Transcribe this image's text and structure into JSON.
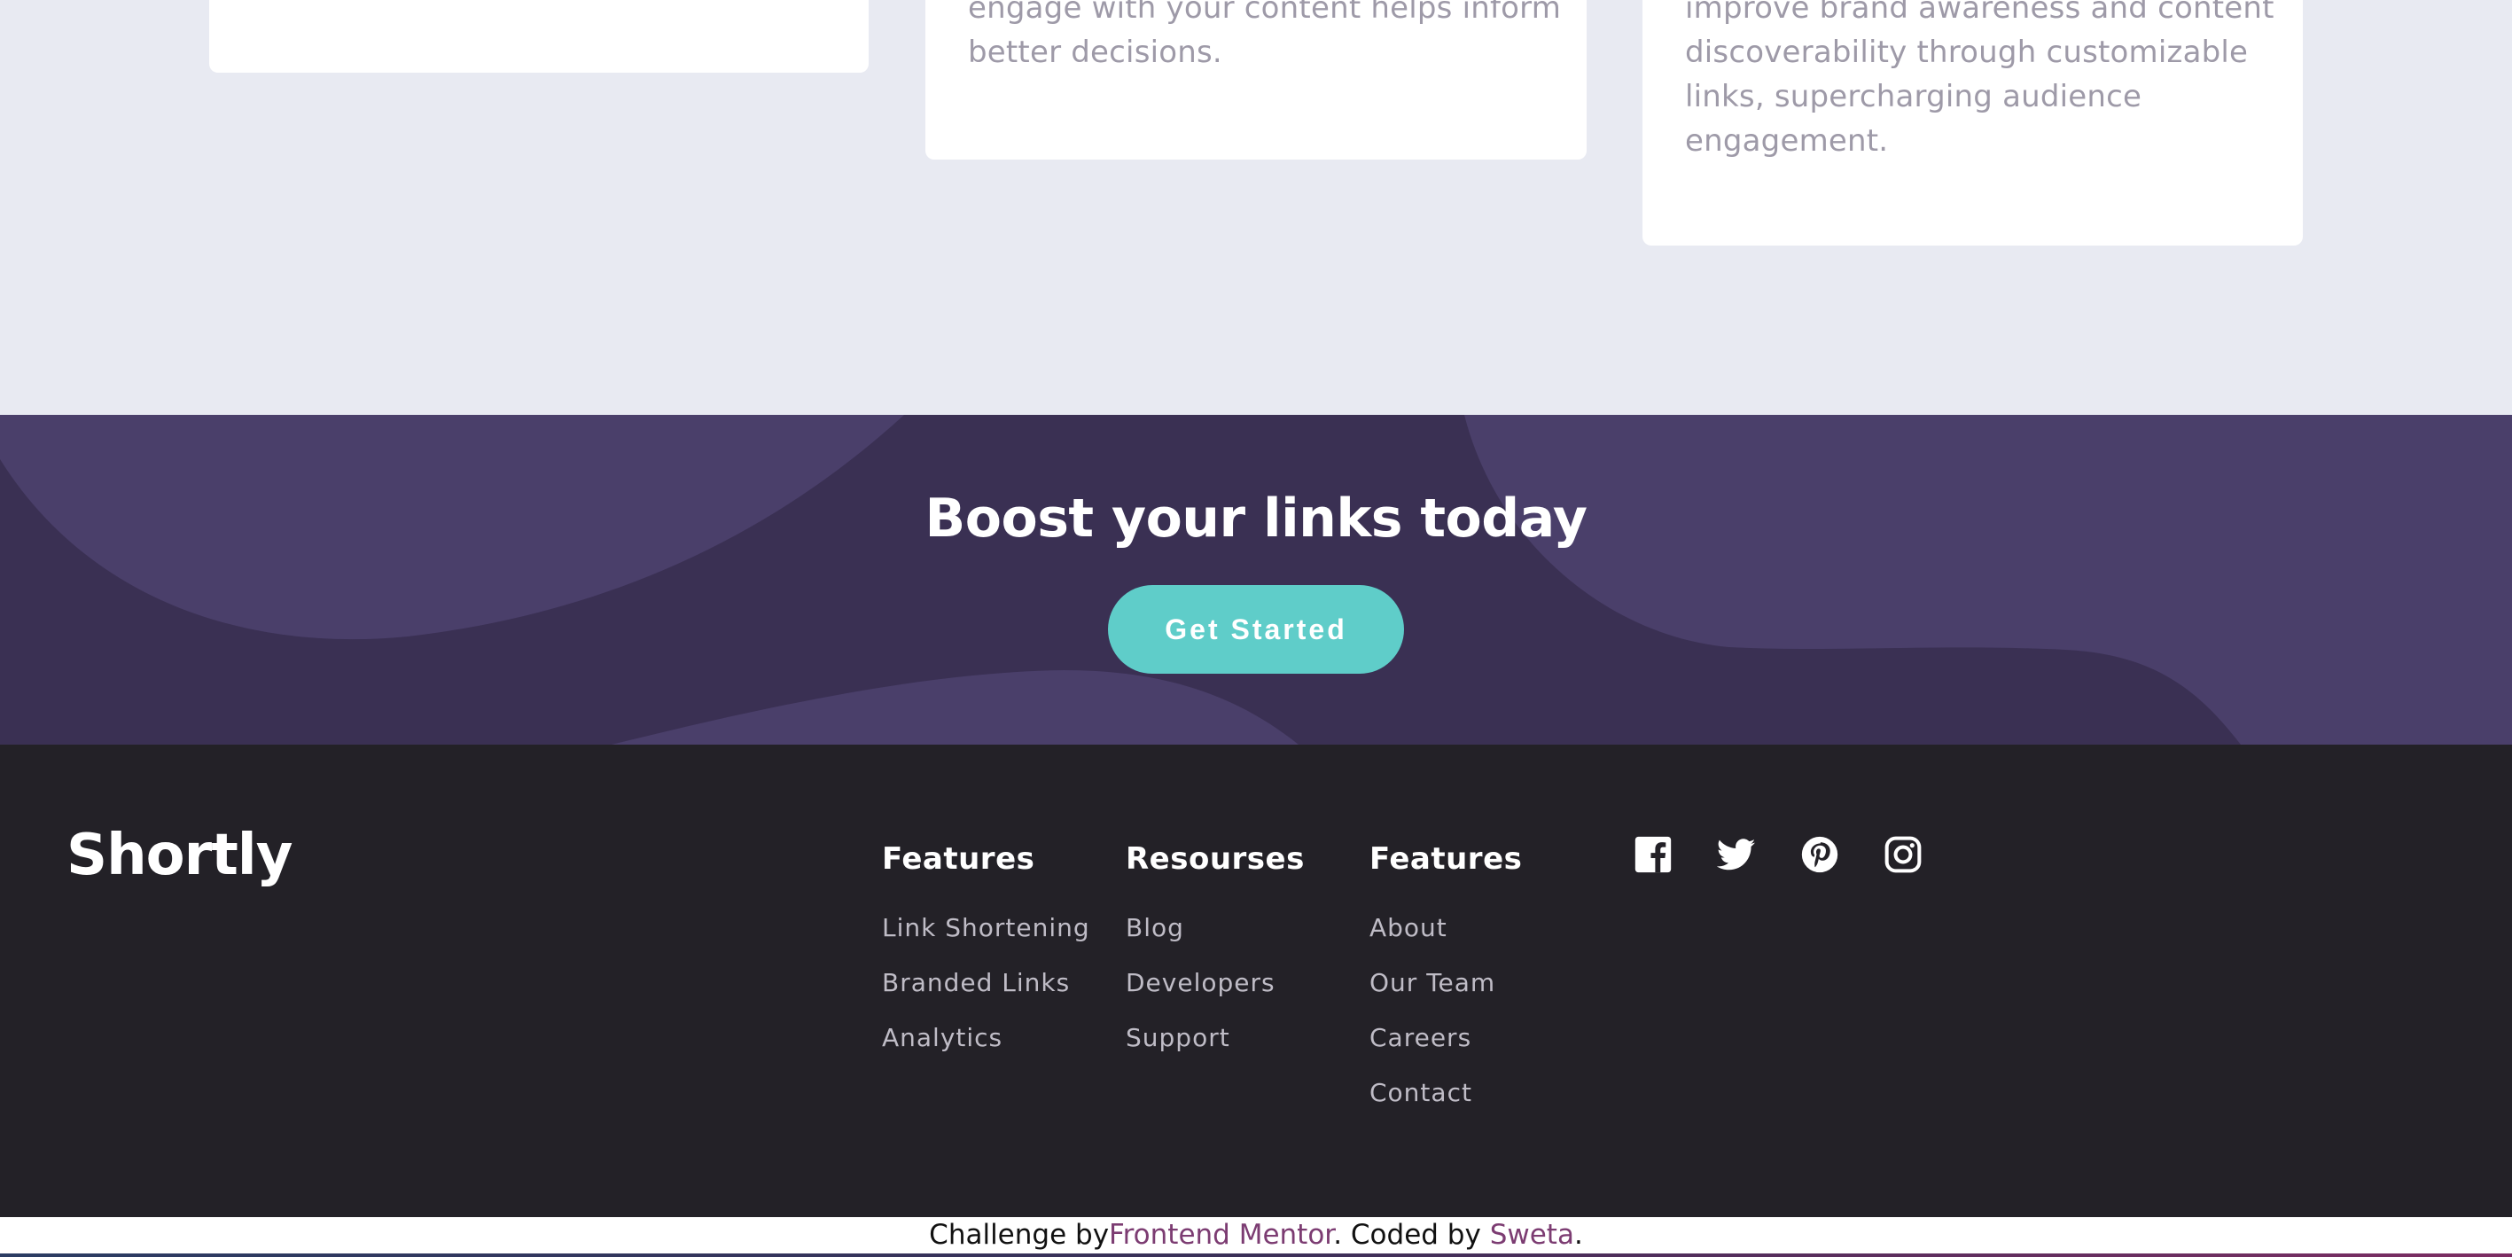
{
  "cards": [
    {
      "lines": []
    },
    {
      "lines": [
        "engage with your content helps inform",
        "better decisions."
      ]
    },
    {
      "lines": [
        "improve brand awareness and content",
        "discoverability through customizable",
        "links, supercharging audience",
        "engagement."
      ]
    }
  ],
  "boost": {
    "title": "Boost your links today",
    "button_label": "Get Started"
  },
  "footer": {
    "logo": "Shortly",
    "columns": [
      {
        "heading": "Features",
        "links": [
          "Link Shortening",
          "Branded Links",
          "Analytics"
        ]
      },
      {
        "heading": "Resourses",
        "links": [
          "Blog",
          "Developers",
          "Support"
        ]
      },
      {
        "heading": "Features",
        "links": [
          "About",
          "Our Team",
          "Careers",
          "Contact"
        ]
      }
    ],
    "social_icons": [
      "facebook-icon",
      "twitter-icon",
      "pinterest-icon",
      "instagram-icon"
    ]
  },
  "attribution": {
    "prefix": "Challenge by",
    "mentor_link": "Frontend Mentor",
    "middle": ". Coded by ",
    "author_link": "Sweta",
    "suffix": "."
  },
  "colors": {
    "background": "#e8eaf2",
    "boost_bg": "#3a3053",
    "cta": "#5fcdc9",
    "footer_bg": "#232127",
    "link_accent": "#7c3c72"
  }
}
